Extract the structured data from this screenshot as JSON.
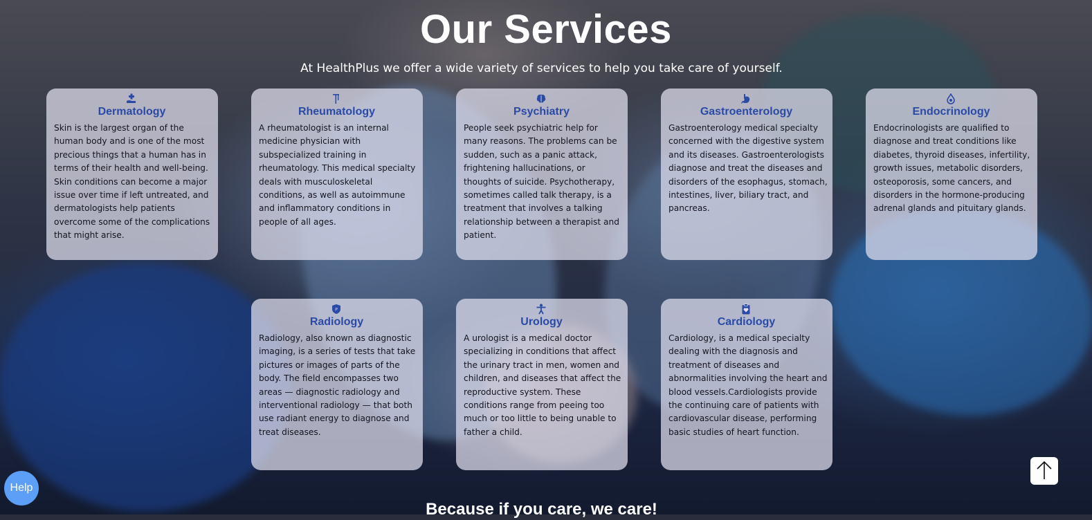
{
  "page": {
    "title": "Our Services",
    "subtitle": "At HealthPlus we offer a wide variety of services to help you take care of yourself.",
    "footer_heading": "Because if you care, we care!"
  },
  "colors": {
    "card_title": "#2a4aa6",
    "card_background": "rgba(226,224,240,0.72)",
    "help_button": "#5b9ff6"
  },
  "services": [
    {
      "icon": "hand-medical-icon",
      "title": "Dermatology",
      "description": "Skin is the largest organ of the human body and is one of the most precious things that a human has in terms of their health and well-being. Skin conditions can become a major issue over time if left untreated, and dermatologists help patients overcome some of the complications that might arise."
    },
    {
      "icon": "crutch-icon",
      "title": "Rheumatology",
      "description": "A rheumatologist is an internal medicine physician with subspecialized training in rheumatology. This medical specialty deals with musculoskeletal conditions, as well as autoimmune and inflammatory conditions in people of all ages."
    },
    {
      "icon": "brain-icon",
      "title": "Psychiatry",
      "description": "People seek psychiatric help for many reasons. The problems can be sudden, such as a panic attack, frightening hallucinations, or thoughts of suicide. Psychotherapy, sometimes called talk therapy, is a treatment that involves a talking relationship between a therapist and patient."
    },
    {
      "icon": "stomach-icon",
      "title": "Gastroenterology",
      "description": "Gastroenterology medical specialty concerned with the digestive system and its diseases. Gastroenterologists diagnose and treat the diseases and disorders of the esophagus, stomach, intestines, liver, biliary tract, and pancreas."
    },
    {
      "icon": "droplet-icon",
      "title": "Endocrinology",
      "description": "Endocrinologists are qualified to diagnose and treat conditions like diabetes, thyroid diseases, infertility, growth issues, metabolic disorders, osteoporosis, some cancers, and disorders in the hormone-producing adrenal glands and pituitary glands."
    },
    {
      "icon": "shield-icon",
      "title": "Radiology",
      "description": "Radiology, also known as diagnostic imaging, is a series of tests that take pictures or images of parts of the body. The field encompasses two areas — diagnostic radiology and interventional radiology — that both use radiant energy to diagnose and treat diseases."
    },
    {
      "icon": "person-icon",
      "title": "Urology",
      "description": "A urologist is a medical doctor specializing in conditions that affect the urinary tract in men, women and children, and diseases that affect the reproductive system. These conditions range from peeing too much or too little to being unable to father a child."
    },
    {
      "icon": "clipboard-heart-icon",
      "title": "Cardiology",
      "description": "Cardiology, is a medical specialty dealing with the diagnosis and treatment of diseases and abnormalities involving the heart and blood vessels.Cardiologists provide the continuing care of patients with cardiovascular disease, performing basic studies of heart function."
    }
  ],
  "help_button": {
    "label": "Help"
  },
  "scroll_top_button": {
    "icon": "arrow-up-icon"
  }
}
